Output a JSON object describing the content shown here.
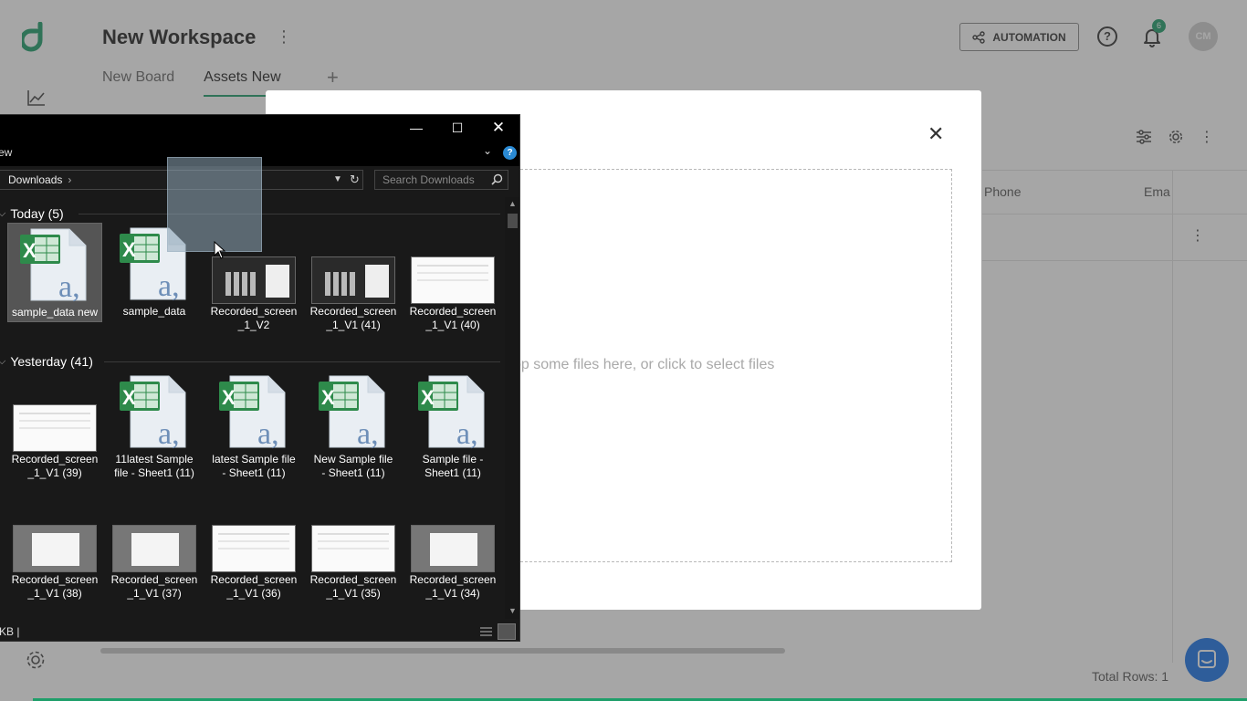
{
  "app": {
    "workspace_title": "New Workspace",
    "tabs": [
      {
        "label": "New Board",
        "active": false
      },
      {
        "label": "Assets New",
        "active": true
      }
    ],
    "automation_label": "AUTOMATION",
    "notification_count": "6",
    "avatar_initials": "CM",
    "grid": {
      "columns": [
        "Phone",
        "Ema"
      ]
    },
    "total_rows": "Total Rows: 1"
  },
  "upload_modal": {
    "dropzone_text": "op some files here, or click to select files"
  },
  "explorer": {
    "ribbon_tab": "ew",
    "address_path": "Downloads",
    "search_placeholder": "Search Downloads",
    "status_text": "KB  |",
    "groups": [
      {
        "label": "Today (5)",
        "files": [
          {
            "name": "sample_data new",
            "type": "excel",
            "selected": true
          },
          {
            "name": "sample_data",
            "type": "excel",
            "selected": false
          },
          {
            "name": "Recorded_screen\n_1_V2",
            "type": "video-dark",
            "selected": false
          },
          {
            "name": "Recorded_screen\n_1_V1 (41)",
            "type": "video-dark",
            "selected": false
          },
          {
            "name": "Recorded_screen\n_1_V1 (40)",
            "type": "video-light",
            "selected": false
          }
        ]
      },
      {
        "label": "Yesterday (41)",
        "files": [
          {
            "name": "Recorded_screen\n_1_V1 (39)",
            "type": "video-light",
            "selected": false
          },
          {
            "name": "11latest Sample\nfile - Sheet1 (11)",
            "type": "excel",
            "selected": false
          },
          {
            "name": "latest Sample file\n- Sheet1 (11)",
            "type": "excel",
            "selected": false
          },
          {
            "name": "New Sample file\n- Sheet1 (11)",
            "type": "excel",
            "selected": false
          },
          {
            "name": "Sample file -\nSheet1 (11)",
            "type": "excel",
            "selected": false
          },
          {
            "name": "Recorded_screen\n_1_V1 (38)",
            "type": "video-grey",
            "selected": false
          },
          {
            "name": "Recorded_screen\n_1_V1 (37)",
            "type": "video-grey",
            "selected": false
          },
          {
            "name": "Recorded_screen\n_1_V1 (36)",
            "type": "video-light",
            "selected": false
          },
          {
            "name": "Recorded_screen\n_1_V1 (35)",
            "type": "video-light",
            "selected": false
          },
          {
            "name": "Recorded_screen\n_1_V1 (34)",
            "type": "video-grey",
            "selected": false
          }
        ]
      }
    ]
  },
  "colors": {
    "brand_green": "#1e9e6a",
    "chat_blue": "#1a73e8",
    "explorer_bg": "#191919"
  },
  "icons": [
    "chart-icon",
    "settings-icon",
    "filter-icon",
    "gear-icon",
    "kebab-icon",
    "help-icon",
    "bell-icon",
    "close-icon",
    "search-icon",
    "refresh-icon",
    "chevron-down-icon",
    "excel-file-icon",
    "video-thumbnail-icon",
    "chat-icon"
  ]
}
